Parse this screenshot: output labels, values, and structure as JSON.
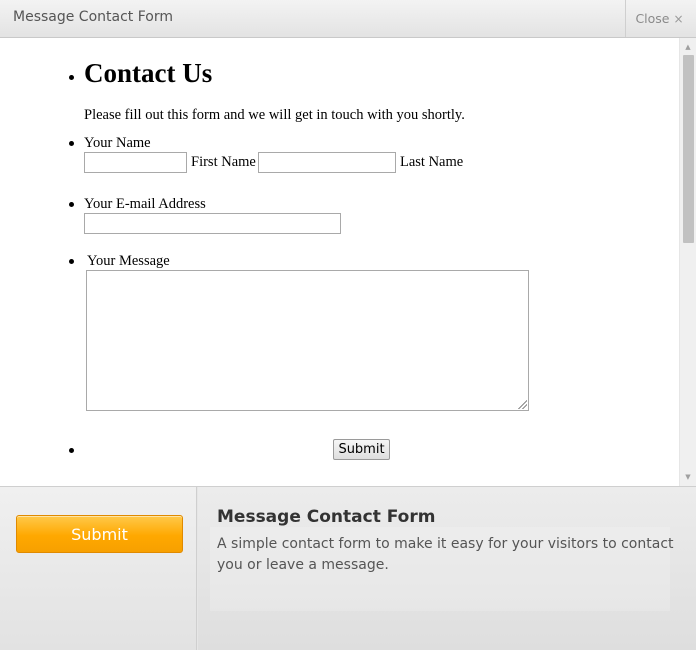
{
  "window": {
    "title": "Message Contact Form",
    "close_label": "Close",
    "close_glyph": "×"
  },
  "form": {
    "heading": "Contact Us",
    "intro": "Please fill out this form and we will get in touch with you shortly.",
    "name_label": "Your Name",
    "first_name_label": "First Name",
    "last_name_label": "Last Name",
    "first_name_value": "",
    "last_name_value": "",
    "email_label": "Your E-mail Address",
    "email_value": "",
    "message_label": "Your Message",
    "message_value": "",
    "submit_label": "Submit"
  },
  "panel": {
    "submit_label": "Submit",
    "submit_color": "#ffa800",
    "info_title": "Message Contact Form",
    "info_description": "A simple contact form to make it easy for your visitors to contact you or leave a message."
  },
  "icons": {
    "close": "close-icon",
    "scroll_up": "scroll-up-arrow-icon",
    "scroll_down": "scroll-down-arrow-icon",
    "resize": "resize-grip-icon"
  }
}
